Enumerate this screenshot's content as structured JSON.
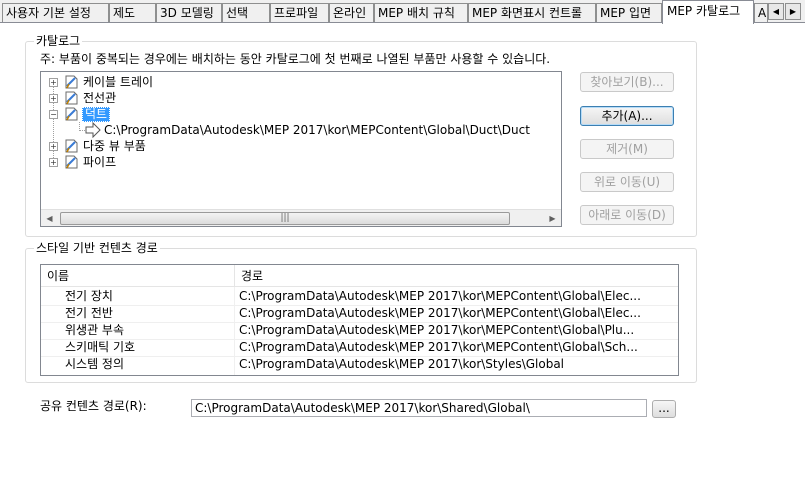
{
  "tabs": [
    {
      "label": "사용자 기본 설정"
    },
    {
      "label": "제도"
    },
    {
      "label": "3D 모델링"
    },
    {
      "label": "선택"
    },
    {
      "label": "프로파일"
    },
    {
      "label": "온라인"
    },
    {
      "label": "MEP 배치 규칙"
    },
    {
      "label": "MEP 화면표시 컨트롤"
    },
    {
      "label": "MEP 입면"
    },
    {
      "label": "MEP 카탈로그",
      "active": true
    },
    {
      "label": "A"
    }
  ],
  "tab_scroll": {
    "left": "◀",
    "right": "▶"
  },
  "catalog": {
    "group_label": "카탈로그",
    "note": "주: 부품이 중복되는 경우에는 배치하는 동안 카탈로그에 첫 번째로 나열된 부품만 사용할 수 있습니다.",
    "tree": [
      {
        "label": "케이블 트레이",
        "expander": "+"
      },
      {
        "label": "전선관",
        "expander": "+"
      },
      {
        "label": "덕트",
        "expander": "−",
        "selected": true
      },
      {
        "label": "C:\\ProgramData\\Autodesk\\MEP 2017\\kor\\MEPContent\\Global\\Duct\\Duct",
        "child": true
      },
      {
        "label": "다중 뷰 부품",
        "expander": "+"
      },
      {
        "label": "파이프",
        "expander": "+"
      }
    ],
    "scroll": {
      "left": "◀",
      "right": "▶",
      "grip": "|||"
    },
    "buttons": {
      "browse": "찾아보기(B)...",
      "add": "추가(A)...",
      "remove": "제거(M)",
      "move_up": "위로 이동(U)",
      "move_down": "아래로 이동(D)"
    }
  },
  "style_paths": {
    "group_label": "스타일 기반 컨텐츠 경로",
    "columns": [
      "이름",
      "경로"
    ],
    "rows": [
      {
        "name": "전기 장치",
        "path": "C:\\ProgramData\\Autodesk\\MEP 2017\\kor\\MEPContent\\Global\\Elec..."
      },
      {
        "name": "전기 전반",
        "path": "C:\\ProgramData\\Autodesk\\MEP 2017\\kor\\MEPContent\\Global\\Elec..."
      },
      {
        "name": "위생관 부속",
        "path": "C:\\ProgramData\\Autodesk\\MEP 2017\\kor\\MEPContent\\Global\\Plu..."
      },
      {
        "name": "스키매틱 기호",
        "path": "C:\\ProgramData\\Autodesk\\MEP 2017\\kor\\MEPContent\\Global\\Sch..."
      },
      {
        "name": "시스템 정의",
        "path": "C:\\ProgramData\\Autodesk\\MEP 2017\\kor\\Styles\\Global"
      }
    ]
  },
  "shared": {
    "label": "공유 컨텐츠 경로(R):",
    "value": "C:\\ProgramData\\Autodesk\\MEP 2017\\kor\\Shared\\Global\\",
    "browse_label": "..."
  },
  "colors": {
    "selection": "#3399ff"
  }
}
